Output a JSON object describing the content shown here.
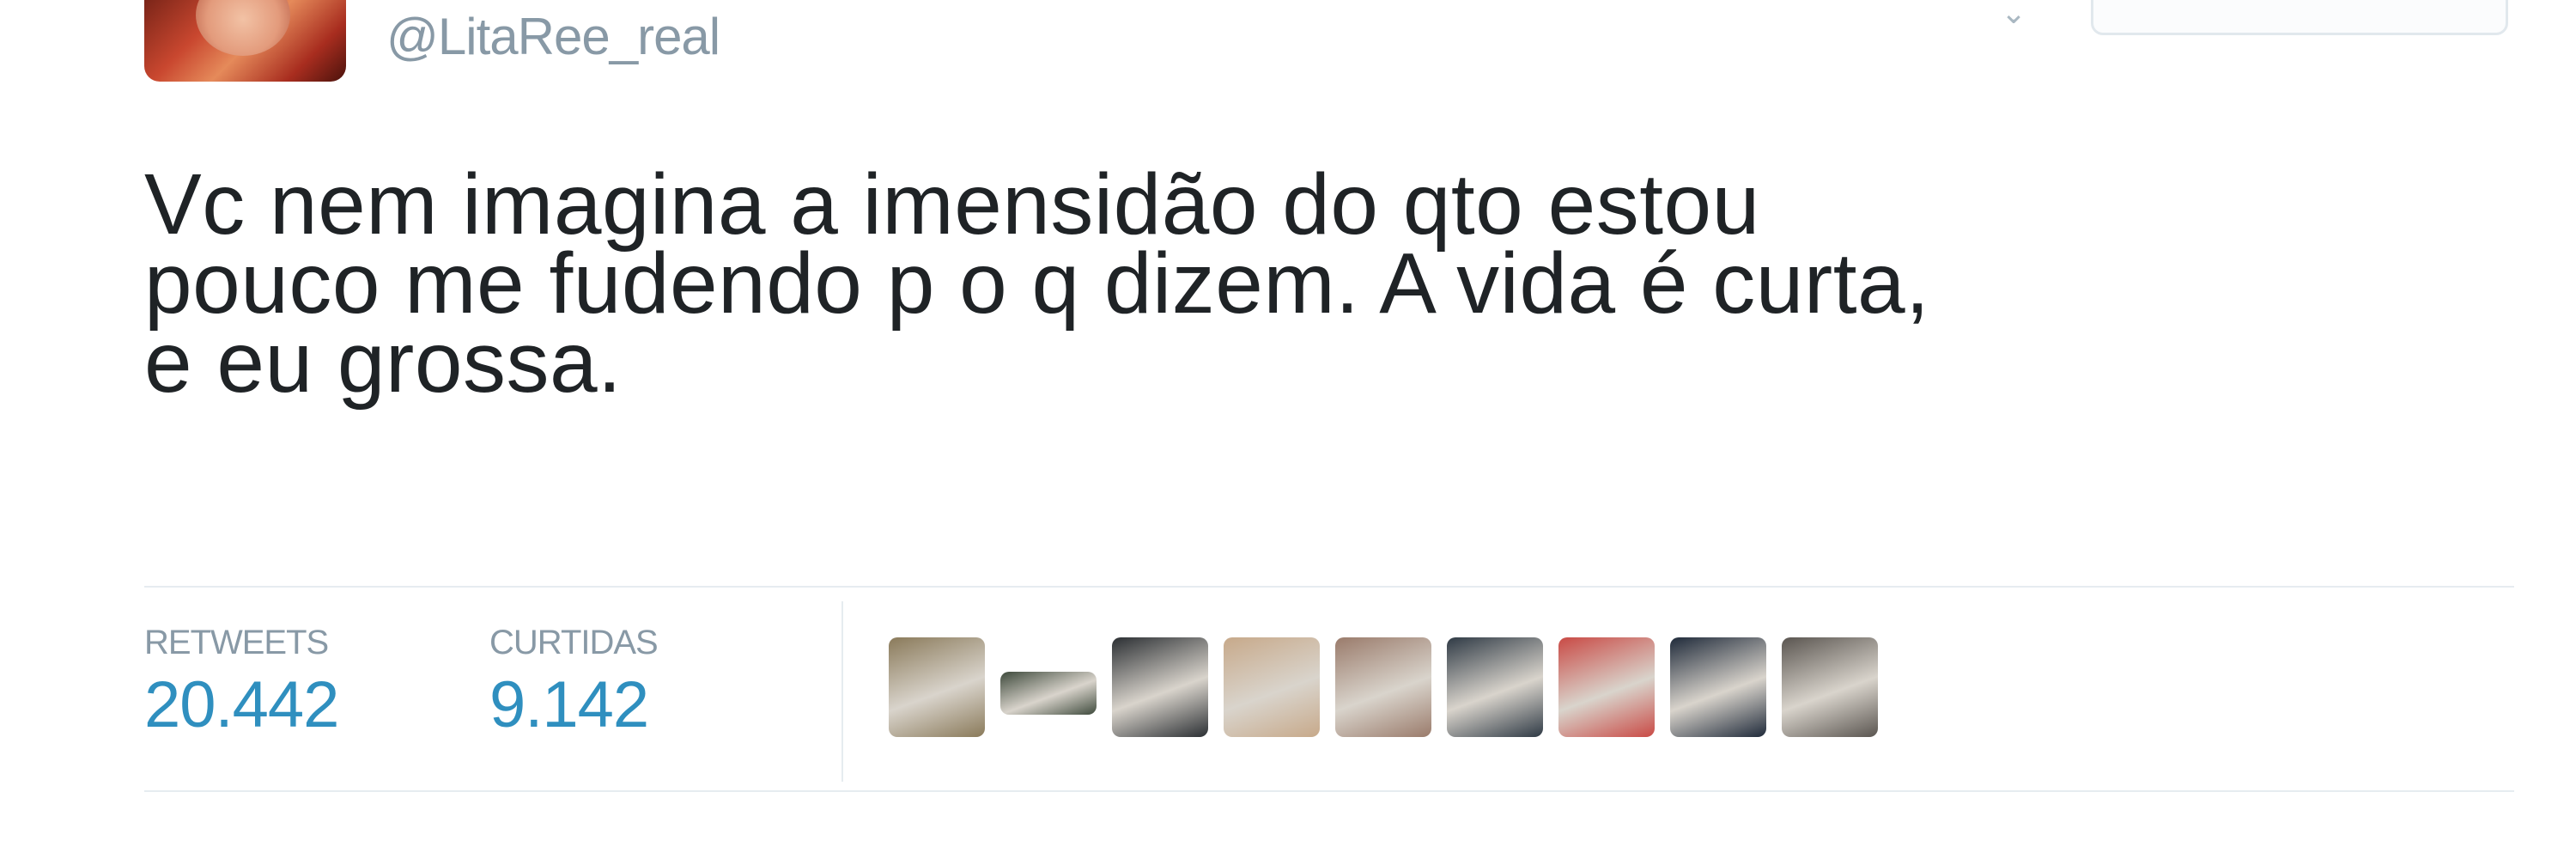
{
  "user": {
    "handle": "@LitaRee_real"
  },
  "tweet": {
    "text_lines": [
      "Vc nem imagina a imensidão do qto estou",
      "pouco me fudendo p o q dizem. A vida é curta,",
      "e eu grossa."
    ]
  },
  "stats": {
    "retweets_label": "RETWEETS",
    "retweets_value": "20.442",
    "likes_label": "CURTIDAS",
    "likes_value": "9.142"
  },
  "liker_avatars": [
    {
      "name": "liker-avatar-1",
      "color": "#8a7a5a"
    },
    {
      "name": "liker-avatar-2",
      "color": "#3e4a3c"
    },
    {
      "name": "liker-avatar-3",
      "color": "#2b2f33"
    },
    {
      "name": "liker-avatar-4",
      "color": "#c7a98a"
    },
    {
      "name": "liker-avatar-5",
      "color": "#9a7b6b"
    },
    {
      "name": "liker-avatar-6",
      "color": "#2f3a45"
    },
    {
      "name": "liker-avatar-7",
      "color": "#c94a45"
    },
    {
      "name": "liker-avatar-8",
      "color": "#1f2a3a"
    },
    {
      "name": "liker-avatar-9",
      "color": "#5a5550"
    }
  ],
  "colors": {
    "link_blue": "#2f8fbf",
    "muted_gray": "#8899a6"
  }
}
